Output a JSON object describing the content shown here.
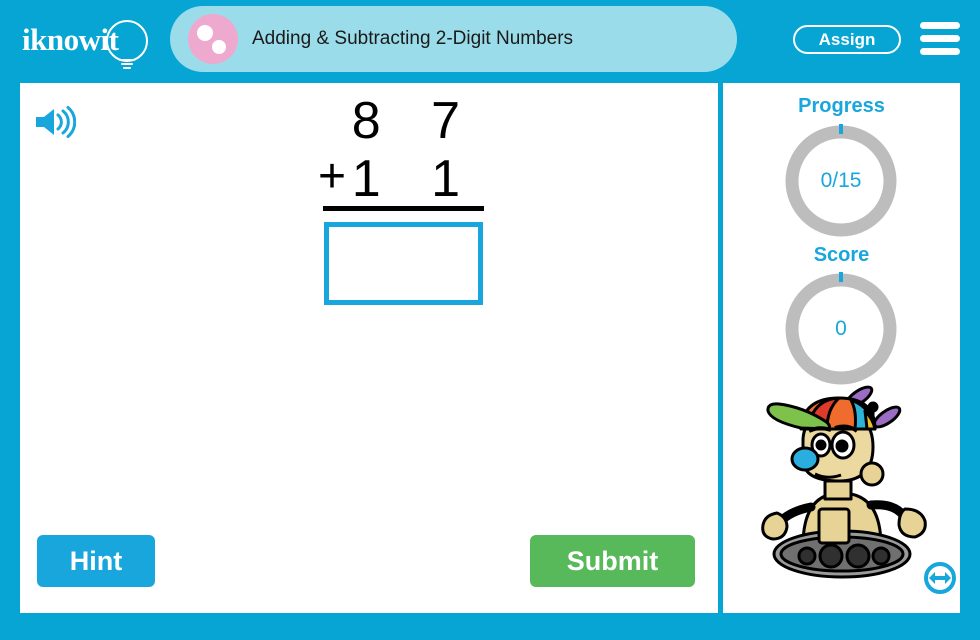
{
  "app": {
    "brand": "iknowit",
    "brand_icon": "lightbulb-icon",
    "accent_color": "#06a5d3",
    "title_bar_color": "#9bdcea",
    "submit_color": "#57b95a",
    "hint_color": "#18a6dc",
    "ring_color": "#bdbdbd"
  },
  "header": {
    "title": "Adding & Subtracting 2-Digit Numbers",
    "title_icon": "two-dots-circle-icon",
    "assign_label": "Assign",
    "menu_icon": "hamburger-menu-icon"
  },
  "main": {
    "speaker_icon": "speaker-audio-icon",
    "problem": {
      "operator": "+",
      "top_number": "8 7",
      "bottom_number": "1 1",
      "answer_value": "",
      "answer_placeholder": ""
    },
    "hint_label": "Hint",
    "submit_label": "Submit"
  },
  "sidebar": {
    "progress": {
      "label": "Progress",
      "value": "0/15"
    },
    "score": {
      "label": "Score",
      "value": "0"
    },
    "mascot_icon": "robot-mascot-icon",
    "resize_icon": "resize-horizontal-icon"
  }
}
